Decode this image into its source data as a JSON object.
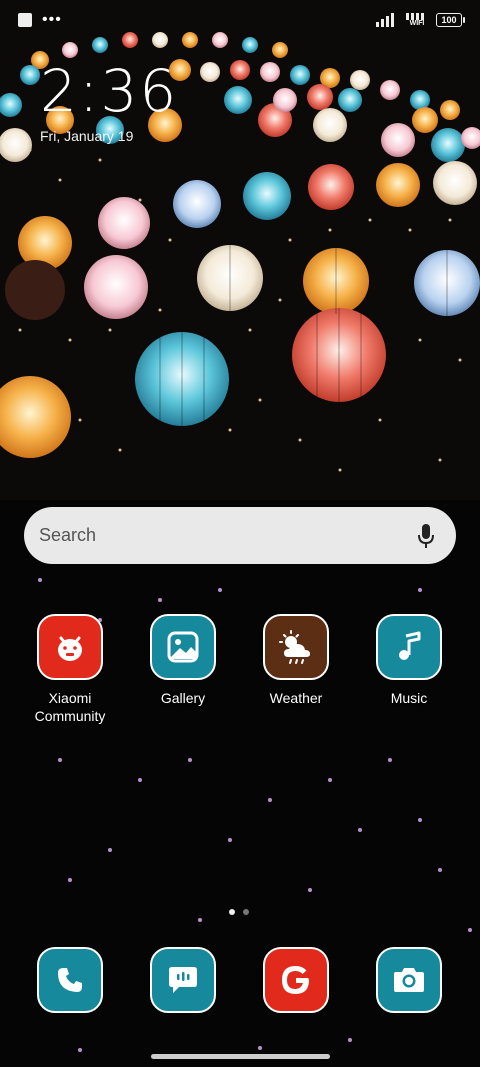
{
  "status_bar": {
    "notification_dots": "•••",
    "wifi_label": "WIFI",
    "battery_level": "100"
  },
  "lock": {
    "time": "2:36",
    "date": "Fri, January 19"
  },
  "search": {
    "label": "Search"
  },
  "apps": [
    {
      "label": "Xiaomi\nCommunity",
      "icon": "mi-bunny-icon",
      "color": "#e12a1c"
    },
    {
      "label": "Gallery",
      "icon": "gallery-icon",
      "color": "#16899c"
    },
    {
      "label": "Weather",
      "icon": "weather-icon",
      "color": "#5c2e14"
    },
    {
      "label": "Music",
      "icon": "music-icon",
      "color": "#16899c"
    }
  ],
  "dock": [
    {
      "icon": "phone-icon",
      "color": "#16899c"
    },
    {
      "icon": "messages-icon",
      "color": "#16899c"
    },
    {
      "icon": "google-icon",
      "color": "#e12a1c"
    },
    {
      "icon": "camera-icon",
      "color": "#16899c"
    }
  ],
  "pager": {
    "pages": 2,
    "current": 1
  }
}
